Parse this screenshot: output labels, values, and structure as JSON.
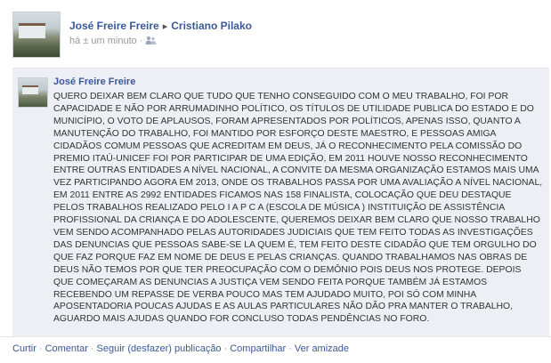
{
  "header": {
    "author": "José Freire Freire",
    "arrow": "▸",
    "recipient": "Cristiano Pilako",
    "timestamp": "há ± um minuto",
    "separator": "·"
  },
  "shared_post": {
    "author": "José Freire Freire",
    "text": "QUERO DEIXAR BEM CLARO QUE TUDO QUE TENHO CONSEGUIDO COM O MEU TRABALHO, FOI POR CAPACIDADE E NÃO POR ARRUMADINHO POLÍTICO, OS TÍTULOS DE UTILIDADE PUBLICA DO ESTADO E DO MUNICÍPIO, O VOTO DE APLAUSOS, FORAM APRESENTADOS POR POLÍTICOS, APENAS ISSO, QUANTO A MANUTENÇÃO DO TRABALHO, FOI MANTIDO POR ESFORÇO DESTE MAESTRO, E PESSOAS AMIGA CIDADÃOS COMUM PESSOAS QUE ACREDITAM EM DEUS, JÁ O RECONHECIMENTO PELA COMISSÃO DO PREMIO ITAÚ-UNICEF FOI POR PARTICIPAR DE UMA EDIÇÃO, EM 2011 HOUVE NOSSO RECONHECIMENTO ENTRE OUTRAS ENTIDADES A NÍVEL NACIONAL, A CONVITE DA MESMA ORGANIZAÇÃO ESTAMOS MAIS UMA VEZ PARTICIPANDO AGORA EM 2013, ONDE OS TRABALHOS PASSA POR UMA AVALIAÇÃO A NÍVEL NACIONAL, EM 2011 ENTRE AS 2992 ENTIDADES FICAMOS NAS 158 FINALISTA, COLOCAÇÃO QUE DEU DESTAQUE PELOS TRABALHOS REALIZADO PELO I A P C A (ESCOLA DE MÚSICA ) INSTITUIÇÃO DE ASSISTÊNCIA PROFISSIONAL DA CRIANÇA E DO ADOLESCENTE, QUEREMOS DEIXAR BEM CLARO QUE NOSSO TRABALHO VEM SENDO ACOMPANHADO PELAS AUTORIDADES JUDICIAIS QUE TEM FEITO TODAS AS INVESTIGAÇÕES DAS DENUNCIAS QUE PESSOAS SABE-SE LA QUEM É, TEM FEITO DESTE CIDADÃO QUE TEM ORGULHO DO QUE FAZ PORQUE FAZ EM NOME DE DEUS E PELAS CRIANÇAS. QUANDO TRABALHAMOS NAS OBRAS DE DEUS NÃO TEMOS POR QUE TER PREOCUPAÇÃO COM O DEMÔNIO POIS DEUS NOS PROTEGE. DEPOIS QUE COMEÇARAM AS DENUNCIAS A JUSTIÇA VEM SENDO FEITA PORQUE TAMBÉM JÁ ESTAMOS RECEBENDO UM REPASSE DE VERBA POUCO MAS TEM AJUDADO MUITO, POI SÓ COM MINHA APOSENTADORIA POUCAS AJUDAS E AS AULAS PARTICULARES NÃO DÃO PRA MANTER O TRABALHO, AGUARDO MAIS AJUDAS QUANDO FOR CONCLUSO TODAS PENDÊNCIAS NO FORO."
  },
  "actions": {
    "like": "Curtir",
    "comment": "Comentar",
    "follow": "Seguir (desfazer) publicação",
    "share": "Compartilhar",
    "see_friendship": "Ver amizade",
    "separator": "·"
  },
  "icons": {
    "audience": "friends-audience-icon"
  },
  "colors": {
    "link": "#3b5998",
    "panel_bg": "#edeff4",
    "meta": "#999999"
  }
}
